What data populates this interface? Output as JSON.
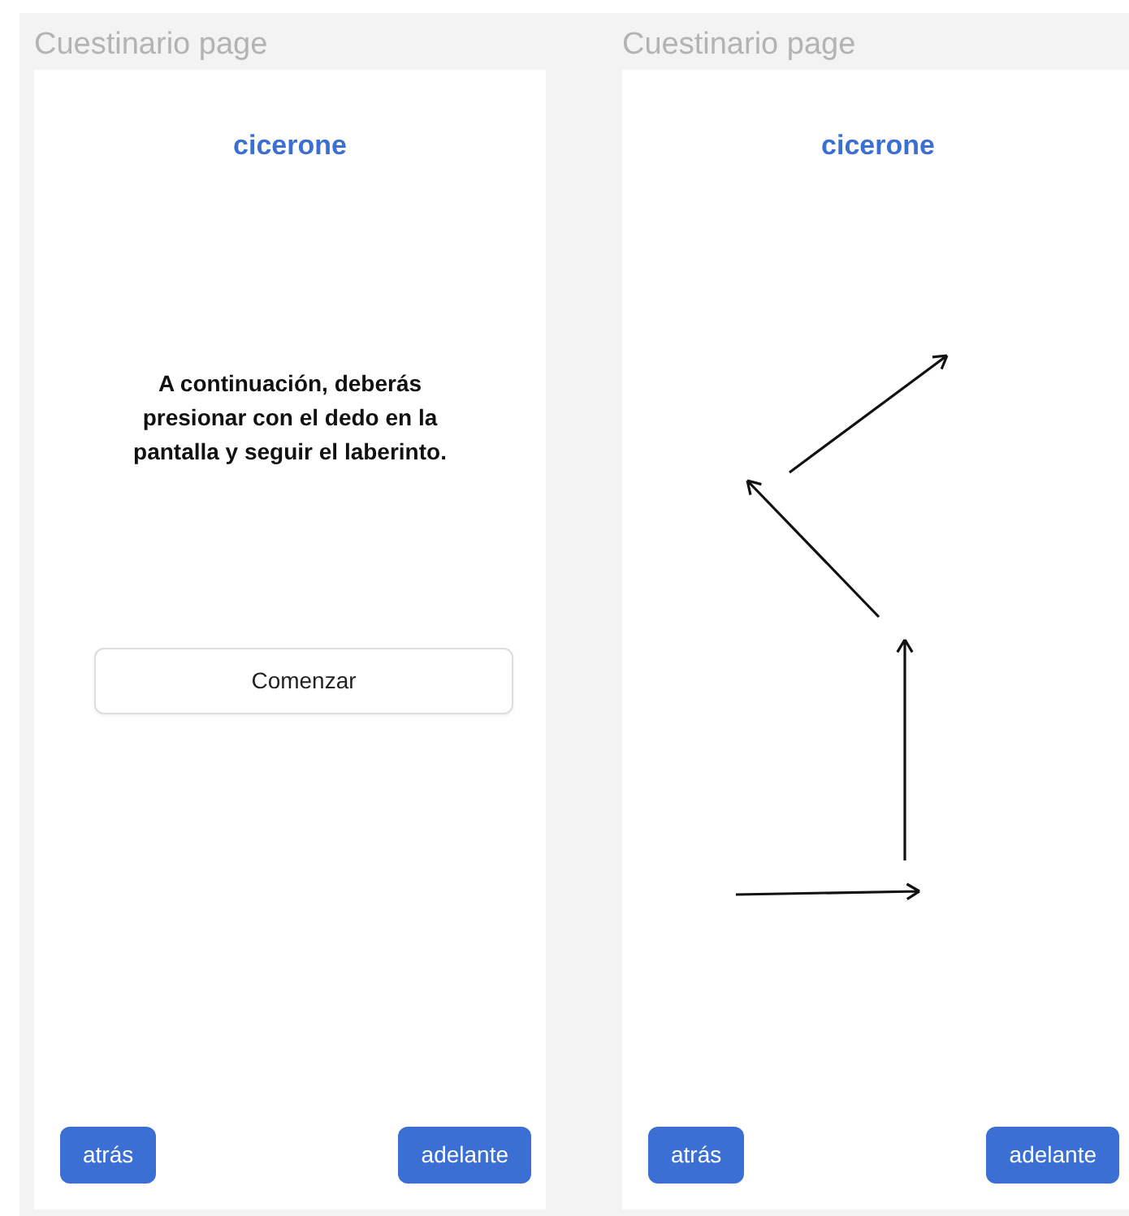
{
  "frames": [
    {
      "title": "Cuestinario page",
      "kind": "intro",
      "logo": "cicerone",
      "message": "A continuación, deberás presionar con el dedo en la pantalla y seguir el laberinto.",
      "start_button": "Comenzar",
      "buttons": [
        "atrás",
        "adelante"
      ]
    },
    {
      "title": "Cuestinario page",
      "kind": "maze",
      "logo": "cicerone",
      "buttons": [
        "atrás",
        "adelante"
      ]
    }
  ]
}
